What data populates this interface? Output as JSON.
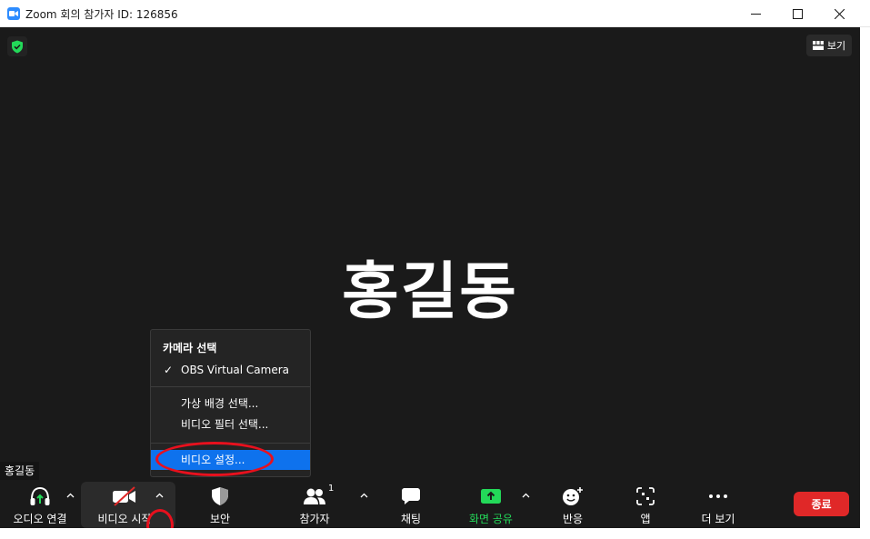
{
  "window": {
    "title": "Zoom 회의 참가자 ID: 126856"
  },
  "header": {
    "view_label": "보기"
  },
  "participant": {
    "display_name": "홍길동",
    "name_tag": "홍길동"
  },
  "camera_menu": {
    "section_title": "카메라 선택",
    "camera_option": "OBS Virtual Camera",
    "virtual_background": "가상 배경 선택...",
    "video_filter": "비디오 필터 선택...",
    "video_settings": "비디오 설정..."
  },
  "toolbar": {
    "audio_label": "오디오 연결",
    "video_label": "비디오 시작",
    "security_label": "보안",
    "participants_label": "참가자",
    "participants_count": "1",
    "chat_label": "채팅",
    "share_label": "화면 공유",
    "reactions_label": "반응",
    "apps_label": "앱",
    "more_label": "더 보기",
    "end_label": "종료"
  },
  "colors": {
    "meeting_bg": "#1a1a1a",
    "accent_blue": "#0e72ed",
    "share_green": "#23d959",
    "end_red": "#e02828",
    "annotation_red": "#e8101d"
  }
}
